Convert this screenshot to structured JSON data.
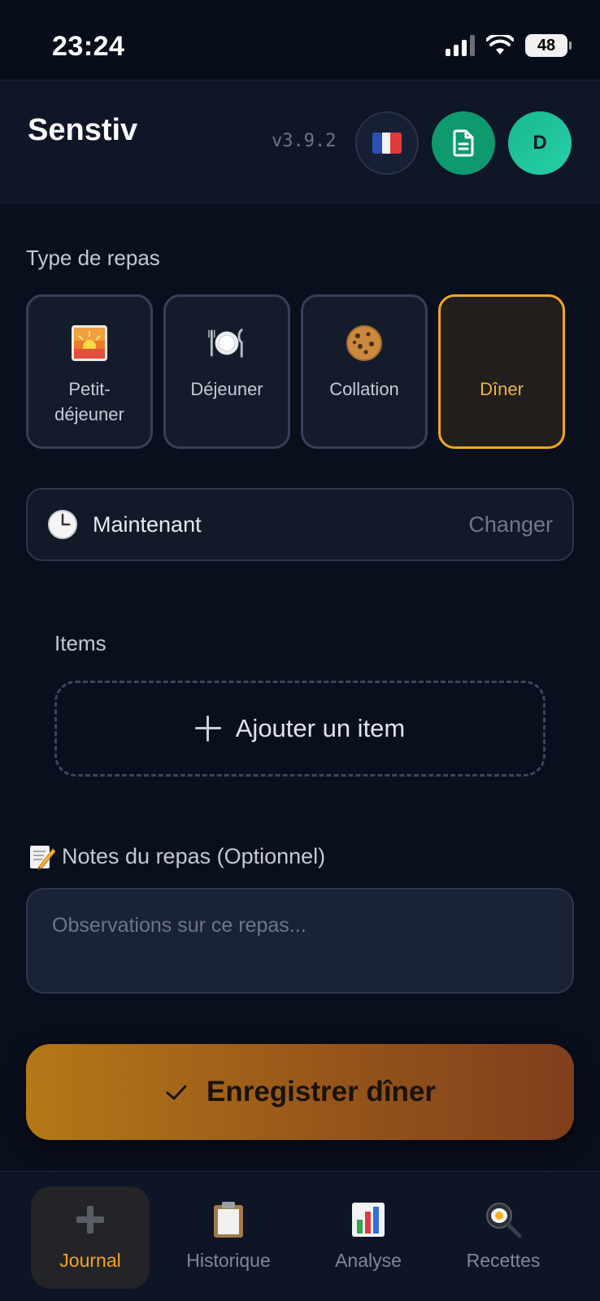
{
  "status_bar": {
    "time": "23:24",
    "battery": "48"
  },
  "header": {
    "title": "Senstiv",
    "version": "v3.9.2",
    "language_flag": "🇫🇷",
    "avatar_initial": "D"
  },
  "meal_type": {
    "label": "Type de repas",
    "options": [
      {
        "label": "Petit-\ndéjeuner",
        "icon": "sunrise-icon",
        "selected": false
      },
      {
        "label": "Déjeuner",
        "icon": "plate-icon",
        "selected": false
      },
      {
        "label": "Collation",
        "icon": "cookie-icon",
        "selected": false
      },
      {
        "label": "Dîner",
        "icon": "moon-icon",
        "selected": true
      }
    ],
    "accent_color": "#f2a61b"
  },
  "time": {
    "label": "Maintenant",
    "change_label": "Changer"
  },
  "items": {
    "label": "Items",
    "add_label": "Ajouter un item"
  },
  "notes": {
    "label": "Notes du repas (Optionnel)",
    "placeholder": "Observations sur ce repas..."
  },
  "save": {
    "label": "Enregistrer dîner"
  },
  "nav": {
    "items": [
      {
        "label": "Journal",
        "icon": "plus-icon",
        "active": true
      },
      {
        "label": "Historique",
        "icon": "clipboard-icon",
        "active": false
      },
      {
        "label": "Analyse",
        "icon": "bar-chart-icon",
        "active": false
      },
      {
        "label": "Recettes",
        "icon": "frying-pan-icon",
        "active": false
      }
    ]
  }
}
